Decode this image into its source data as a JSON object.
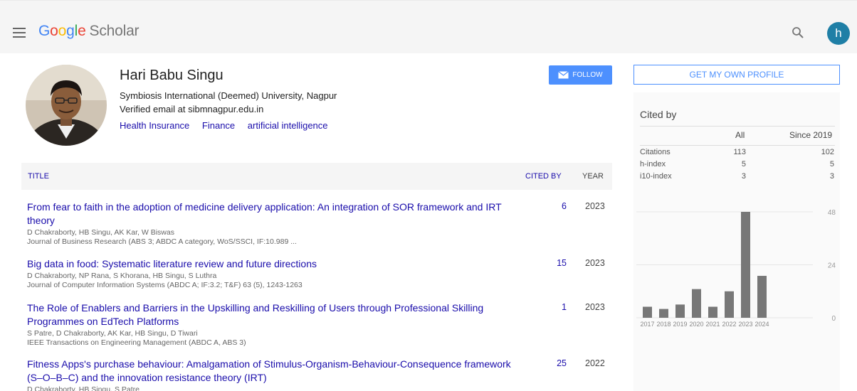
{
  "header": {
    "logo_google": [
      "G",
      "o",
      "o",
      "g",
      "l",
      "e"
    ],
    "logo_scholar": "Scholar",
    "avatar_letter": "h"
  },
  "profile": {
    "name": "Hari Babu Singu",
    "affiliation": "Symbiosis International (Deemed) University, Nagpur",
    "email": "Verified email at sibmnagpur.edu.in",
    "interests": [
      "Health Insurance",
      "Finance",
      "artificial intelligence"
    ],
    "follow_label": "FOLLOW"
  },
  "table": {
    "col_title": "TITLE",
    "col_cited": "CITED BY",
    "col_year": "YEAR",
    "rows": [
      {
        "title": "From fear to faith in the adoption of medicine delivery application: An integration of SOR framework and IRT theory",
        "authors": "D Chakraborty, HB Singu, AK Kar, W Biswas",
        "venue": "Journal of Business Research (ABS 3; ABDC A category, WoS/SSCI, IF:10.989 ...",
        "cited": "6",
        "year": "2023"
      },
      {
        "title": "Big data in food: Systematic literature review and future directions",
        "authors": "D Chakraborty, NP Rana, S Khorana, HB Singu, S Luthra",
        "venue": "Journal of Computer Information Systems (ABDC A; IF:3.2; T&F) 63 (5), 1243-1263",
        "cited": "15",
        "year": "2023"
      },
      {
        "title": "The Role of Enablers and Barriers in the Upskilling and Reskilling of Users through Professional Skilling Programmes on EdTech Platforms",
        "authors": "S Patre, D Chakraborty, AK Kar, HB Singu, D Tiwari",
        "venue": "IEEE Transactions on Engineering Management (ABDC A, ABS 3)",
        "cited": "1",
        "year": "2023"
      },
      {
        "title": "Fitness Apps's purchase behaviour: Amalgamation of Stimulus-Organism-Behaviour-Consequence framework (S–O–B–C) and the innovation resistance theory (IRT)",
        "authors": "D Chakraborty, HB Singu, S Patre",
        "venue": "",
        "cited": "25",
        "year": "2022"
      }
    ]
  },
  "sidebar": {
    "own_profile_label": "GET MY OWN PROFILE",
    "cited_by_title": "Cited by",
    "col_all": "All",
    "col_since": "Since 2019",
    "metrics": [
      {
        "label": "Citations",
        "all": "113",
        "since": "102"
      },
      {
        "label": "h-index",
        "all": "5",
        "since": "5"
      },
      {
        "label": "i10-index",
        "all": "3",
        "since": "3"
      }
    ]
  },
  "chart_data": {
    "type": "bar",
    "categories": [
      "2017",
      "2018",
      "2019",
      "2020",
      "2021",
      "2022",
      "2023",
      "2024"
    ],
    "values": [
      5,
      4,
      6,
      13,
      5,
      12,
      48,
      19
    ],
    "yticks": [
      "48",
      "24",
      "0"
    ],
    "ylim": [
      0,
      48
    ],
    "bar_color": "#777777"
  },
  "colors": {
    "link": "#1a0dab",
    "accent": "#4d90fe",
    "avatar": "#1f7fa6"
  }
}
